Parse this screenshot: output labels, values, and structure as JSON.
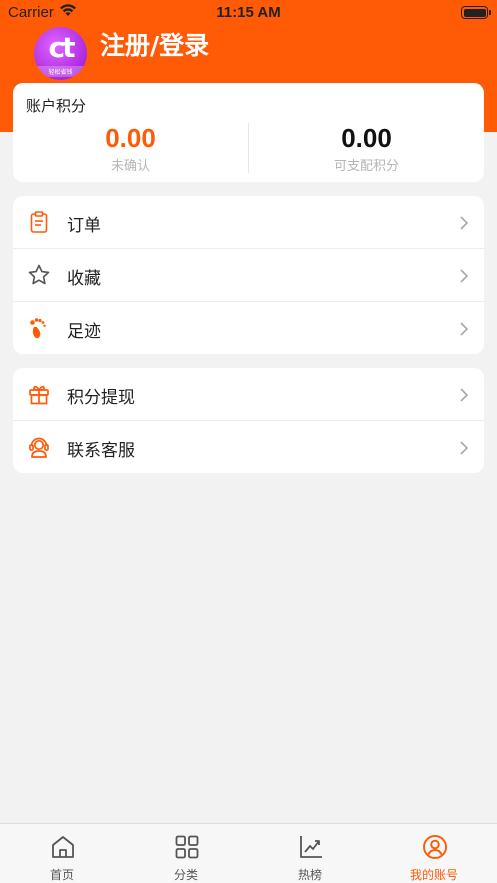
{
  "status_bar": {
    "carrier": "Carrier",
    "time": "11:15 AM"
  },
  "header": {
    "login_title": "注册/登录",
    "avatar_letters": "ct",
    "avatar_subtitle": "轻松省钱",
    "background_color": "#ff5a06"
  },
  "points": {
    "title": "账户积分",
    "unconfirmed_value": "0.00",
    "unconfirmed_label": "未确认",
    "available_value": "0.00",
    "available_label": "可支配积分"
  },
  "menu_group_1": [
    {
      "label": "订单",
      "icon": "clipboard-icon"
    },
    {
      "label": "收藏",
      "icon": "star-icon"
    },
    {
      "label": "足迹",
      "icon": "footprint-icon"
    }
  ],
  "menu_group_2": [
    {
      "label": "积分提现",
      "icon": "gift-icon"
    },
    {
      "label": "联系客服",
      "icon": "headset-icon"
    }
  ],
  "tabs": [
    {
      "label": "首页",
      "icon": "home-icon"
    },
    {
      "label": "分类",
      "icon": "grid-icon"
    },
    {
      "label": "热榜",
      "icon": "trend-chart-icon"
    },
    {
      "label": "我的账号",
      "icon": "user-circle-icon",
      "active": true
    }
  ],
  "colors": {
    "accent": "#ff5a06",
    "background": "#f2f2f2"
  }
}
